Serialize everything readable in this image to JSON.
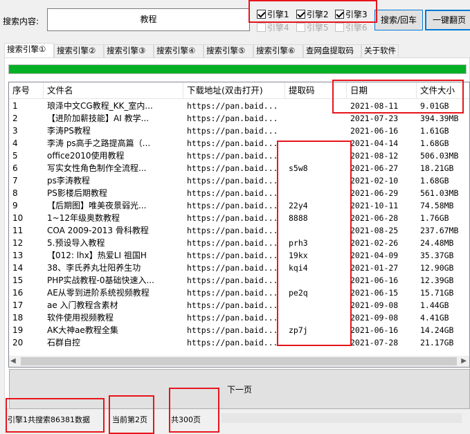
{
  "search": {
    "label": "搜索内容:",
    "value": "教程",
    "search_button": "搜索/回车",
    "flip_button": "一键翻页"
  },
  "engines": [
    {
      "label": "引擎1",
      "checked": true,
      "enabled": true
    },
    {
      "label": "引擎2",
      "checked": true,
      "enabled": true
    },
    {
      "label": "引擎3",
      "checked": true,
      "enabled": true
    },
    {
      "label": "引擎4",
      "checked": false,
      "enabled": false
    },
    {
      "label": "引擎5",
      "checked": false,
      "enabled": false
    },
    {
      "label": "引擎6",
      "checked": false,
      "enabled": false
    }
  ],
  "tabs": [
    "搜索引擎①",
    "搜索引擎②",
    "搜索引擎③",
    "搜索引擎④",
    "搜索引擎⑤",
    "搜索引擎⑥",
    "查网盘提取码",
    "关于软件"
  ],
  "progress_fraction": 1.0,
  "table": {
    "headers": [
      "序号",
      "文件名",
      "下载地址(双击打开)",
      "提取码",
      "日期",
      "文件大小"
    ],
    "rows": [
      [
        "1",
        "琅泽中文CG教程_KK_室内...",
        "https://pan.baid...",
        "",
        "2021-08-11",
        "9.01GB"
      ],
      [
        "2",
        "【进阶加薪技能】AI 教学...",
        "https://pan.baid...",
        "",
        "2021-07-23",
        "394.39MB"
      ],
      [
        "3",
        "李涛PS教程",
        "https://pan.baid...",
        "",
        "2021-06-16",
        "1.61GB"
      ],
      [
        "4",
        "李涛 ps高手之路提高篇（...",
        "https://pan.baid...",
        "",
        "2021-04-14",
        "1.68GB"
      ],
      [
        "5",
        "office2010使用教程",
        "https://pan.baid...",
        "",
        "2021-08-12",
        "506.03MB"
      ],
      [
        "6",
        "写实女性角色制作全流程...",
        "https://pan.baid...",
        "s5w8",
        "2021-06-27",
        "18.21GB"
      ],
      [
        "7",
        "ps李涛教程",
        "https://pan.baid...",
        "",
        "2021-02-10",
        "1.68GB"
      ],
      [
        "8",
        "PS影楼后期教程",
        "https://pan.baid...",
        "",
        "2021-06-29",
        "561.03MB"
      ],
      [
        "9",
        "【后期图】唯美夜景弱光...",
        "https://pan.baid...",
        "22y4",
        "2021-10-11",
        "74.58MB"
      ],
      [
        "10",
        "1~12年级奥数教程",
        "https://pan.baid...",
        "8888",
        "2021-06-28",
        "1.76GB"
      ],
      [
        "11",
        "COA 2009-2013 骨科教程",
        "https://pan.baid...",
        "",
        "2021-08-25",
        "237.67MB"
      ],
      [
        "12",
        "5.预设导入教程",
        "https://pan.baid...",
        "prh3",
        "2021-02-26",
        "24.48MB"
      ],
      [
        "13",
        "【012: lhx】热爱LI 祖国H",
        "https://pan.baid...",
        "19kx",
        "2021-04-09",
        "35.37GB"
      ],
      [
        "14",
        "38、李氏养丸壮阳养生功",
        "https://pan.baid...",
        "kqi4",
        "2021-01-27",
        "12.90GB"
      ],
      [
        "15",
        "PHP实战教程-0基础快速入...",
        "https://pan.baid...",
        "",
        "2021-06-16",
        "12.39GB"
      ],
      [
        "16",
        "AE从零到进阶系统视频教程",
        "https://pan.baid...",
        "pe2q",
        "2021-06-15",
        "15.71GB"
      ],
      [
        "17",
        "ae 入门教程含素材",
        "https://pan.baid...",
        "",
        "2021-09-08",
        "1.44GB"
      ],
      [
        "18",
        "软件使用视频教程",
        "https://pan.baid...",
        "",
        "2021-09-08",
        "4.41GB"
      ],
      [
        "19",
        "AK大神ae教程全集",
        "https://pan.baid...",
        "zp7j",
        "2021-06-16",
        "14.24GB"
      ],
      [
        "20",
        "石群自控",
        "https://pan.baid...",
        "",
        "2021-07-28",
        "21.17GB"
      ]
    ]
  },
  "next_page_button": "下一页",
  "status": {
    "total": "引擎1共搜索86381数据",
    "current": "当前第2页",
    "pages": "共300页"
  },
  "colors": {
    "progress": "#06b025",
    "annotation": "#e8141b",
    "accent": "#0078d7"
  }
}
